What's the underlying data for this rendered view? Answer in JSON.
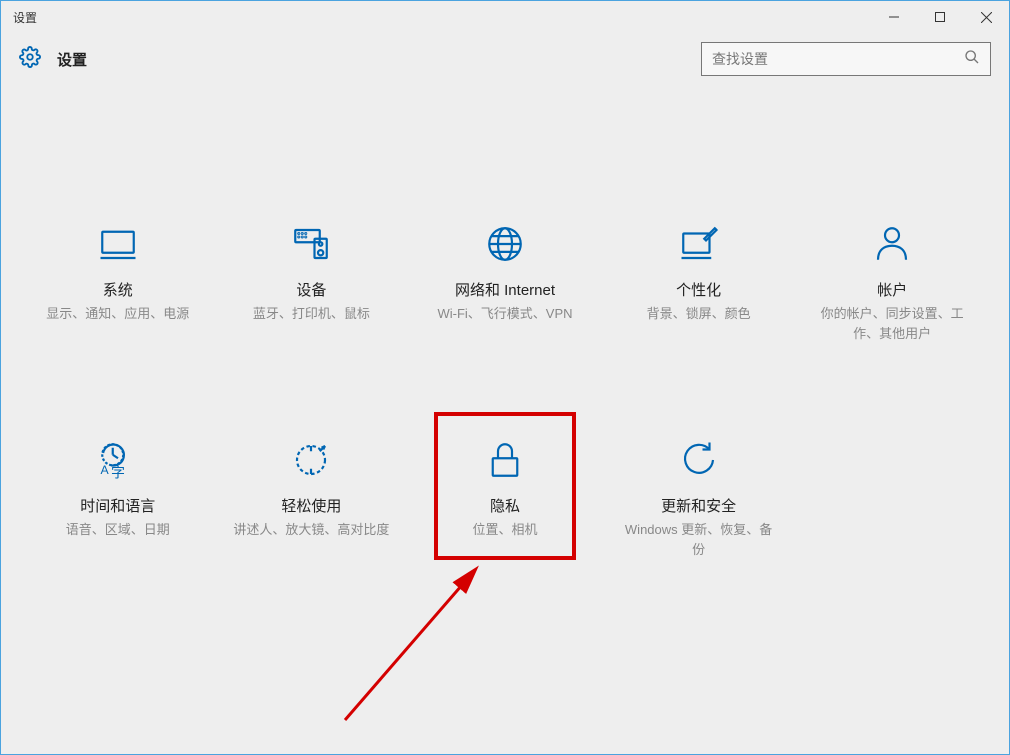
{
  "window": {
    "title": "设置"
  },
  "header": {
    "title": "设置"
  },
  "search": {
    "placeholder": "查找设置"
  },
  "tiles": [
    {
      "id": "system",
      "title": "系统",
      "desc": "显示、通知、应用、电源"
    },
    {
      "id": "devices",
      "title": "设备",
      "desc": "蓝牙、打印机、鼠标"
    },
    {
      "id": "network",
      "title": "网络和 Internet",
      "desc": "Wi-Fi、飞行模式、VPN"
    },
    {
      "id": "personalization",
      "title": "个性化",
      "desc": "背景、锁屏、颜色"
    },
    {
      "id": "accounts",
      "title": "帐户",
      "desc": "你的帐户、同步设置、工作、其他用户"
    },
    {
      "id": "time-language",
      "title": "时间和语言",
      "desc": "语音、区域、日期"
    },
    {
      "id": "ease-of-access",
      "title": "轻松使用",
      "desc": "讲述人、放大镜、高对比度"
    },
    {
      "id": "privacy",
      "title": "隐私",
      "desc": "位置、相机"
    },
    {
      "id": "update-security",
      "title": "更新和安全",
      "desc": "Windows 更新、恢复、备份"
    }
  ]
}
